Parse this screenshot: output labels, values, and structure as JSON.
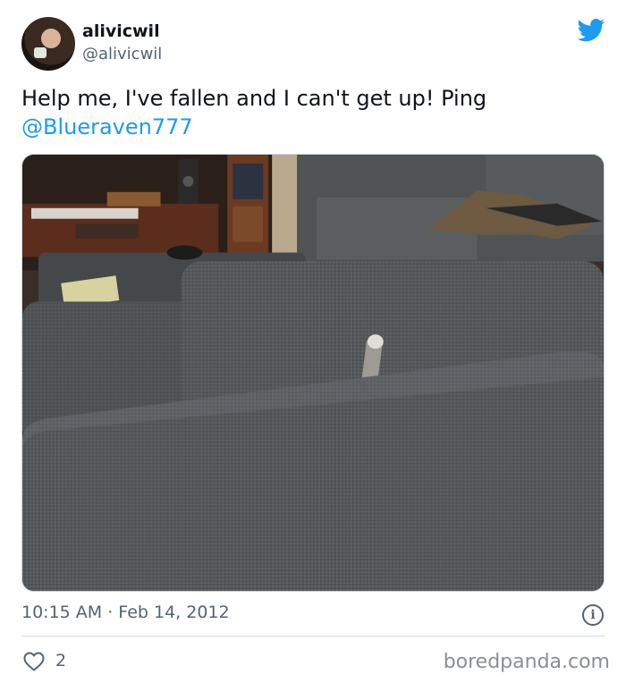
{
  "author": {
    "display_name": "alivicwil",
    "handle": "@alivicwil"
  },
  "tweet": {
    "text": "Help me, I've fallen and I can't get up! Ping",
    "mention": "@Blueraven777",
    "timestamp": "10:15 AM · Feb 14, 2012",
    "likes": "2"
  },
  "icons": {
    "brand": "twitter-bird-icon",
    "info": "info-icon",
    "like": "heart-icon"
  },
  "colors": {
    "accent": "#1d9bf0",
    "muted": "#536471"
  },
  "watermark": "boredpanda.com"
}
